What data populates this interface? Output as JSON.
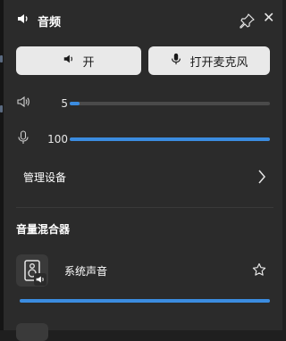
{
  "header": {
    "title": "音频",
    "icon": "speaker-icon"
  },
  "buttons": {
    "output": {
      "label": "开",
      "icon": "speaker-icon"
    },
    "mic": {
      "label": "打开麦克风",
      "icon": "microphone-icon"
    }
  },
  "output_volume": {
    "value": "5",
    "level": 0.05,
    "icon": "speaker-icon"
  },
  "mic_volume": {
    "value": "100",
    "level": 1.0,
    "icon": "microphone-icon"
  },
  "manage_devices": {
    "label": "管理设备"
  },
  "mixer": {
    "title": "音量混合器",
    "apps": [
      {
        "name": "系统声音",
        "level": 1.0,
        "icon": "speaker-device-icon"
      }
    ]
  },
  "colors": {
    "accent": "#3b8ce0",
    "panel": "#2b2b2b",
    "button": "#e9e9e9"
  }
}
